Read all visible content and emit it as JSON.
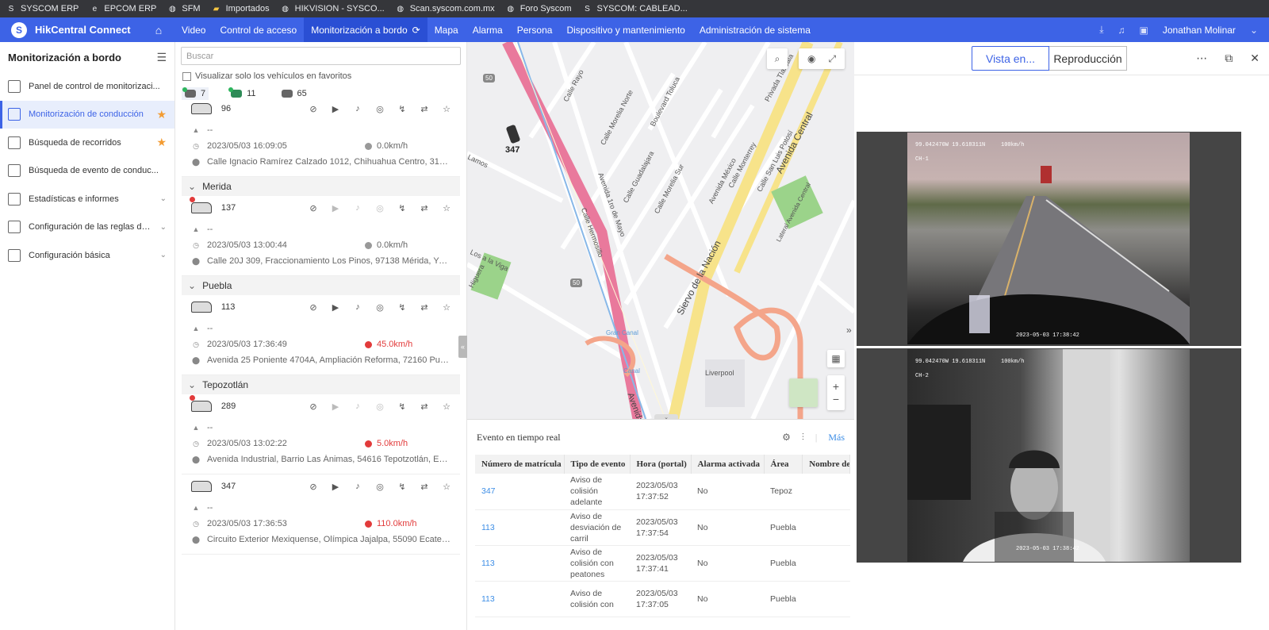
{
  "bookmarks": [
    {
      "icon": "syscom-icon",
      "label": "SYSCOM ERP"
    },
    {
      "icon": "epcom-icon",
      "label": "EPCOM ERP"
    },
    {
      "icon": "globe-icon",
      "label": "SFM"
    },
    {
      "icon": "folder-icon",
      "label": "Importados"
    },
    {
      "icon": "globe-icon",
      "label": "HIKVISION - SYSCO..."
    },
    {
      "icon": "globe-icon",
      "label": "Scan.syscom.com.mx"
    },
    {
      "icon": "globe-icon",
      "label": "Foro Syscom"
    },
    {
      "icon": "syscom-icon",
      "label": "SYSCOM: CABLEAD..."
    }
  ],
  "app": {
    "name": "HikCentral Connect",
    "nav": [
      "Video",
      "Control de acceso",
      "Monitorización a bordo",
      "Mapa",
      "Alarma",
      "Persona",
      "Dispositivo y mantenimiento",
      "Administración de sistema"
    ],
    "active_nav": "Monitorización a bordo",
    "user": "Jonathan Molinar"
  },
  "sidebar": {
    "title": "Monitorización a bordo",
    "items": [
      {
        "label": "Panel de control de monitorizaci...",
        "active": false,
        "star": false,
        "expand": false
      },
      {
        "label": "Monitorización de conducción",
        "active": true,
        "star": true,
        "expand": false
      },
      {
        "label": "Búsqueda de recorridos",
        "active": false,
        "star": true,
        "expand": false
      },
      {
        "label": "Búsqueda de evento de conduc...",
        "active": false,
        "star": false,
        "expand": false
      },
      {
        "label": "Estadísticas e informes",
        "active": false,
        "star": false,
        "expand": true
      },
      {
        "label": "Configuración de las reglas de c...",
        "active": false,
        "star": false,
        "expand": true
      },
      {
        "label": "Configuración básica",
        "active": false,
        "star": false,
        "expand": true
      }
    ]
  },
  "vehicles": {
    "search_placeholder": "Buscar",
    "favorites_label": "Visualizar solo los vehículos en favoritos",
    "counts": [
      "7",
      "11",
      "65"
    ],
    "groups": [
      {
        "name": "",
        "items": [
          {
            "id": "96",
            "offline": false,
            "driver": "--",
            "time": "2023/05/03 16:09:05",
            "speed": "0.0km/h",
            "alert": false,
            "address": "Calle Ignacio Ramírez Calzado 1012, Chihuahua Centro, 31000 Chi..."
          }
        ]
      },
      {
        "name": "Merida",
        "items": [
          {
            "id": "137",
            "offline": true,
            "driver": "--",
            "time": "2023/05/03 13:00:44",
            "speed": "0.0km/h",
            "alert": false,
            "address": "Calle 20J 309, Fraccionamiento Los Pinos, 97138 Mérida, Yuc, Méxi..."
          }
        ]
      },
      {
        "name": "Puebla",
        "items": [
          {
            "id": "113",
            "offline": false,
            "driver": "--",
            "time": "2023/05/03 17:36:49",
            "speed": "45.0km/h",
            "alert": true,
            "address": "Avenida 25 Poniente 4704A, Ampliación Reforma, 72160 Puebla, P..."
          }
        ]
      },
      {
        "name": "Tepozotlán",
        "items": [
          {
            "id": "289",
            "offline": true,
            "driver": "--",
            "time": "2023/05/03 13:02:22",
            "speed": "5.0km/h",
            "alert": true,
            "address": "Avenida Industrial, Barrio Las Ánimas, 54616 Tepotzotlán, Edomex,..."
          },
          {
            "id": "347",
            "offline": false,
            "driver": "--",
            "time": "2023/05/03 17:36:53",
            "speed": "110.0km/h",
            "alert": true,
            "address": "Circuito Exterior Mexiquense, Olímpica Jajalpa, 55090 Ecatepec de..."
          }
        ]
      }
    ]
  },
  "map": {
    "vehicle_label": "347",
    "labels": [
      "Calle Rayo",
      "Calle Morelia Norte",
      "Boulevard Toluca",
      "Calle Guadalajara",
      "Calle Morelia Sur",
      "Avenida México",
      "Calle Monterrey",
      "Calle San Luis Potosí",
      "Privada Tlaxcala",
      "Avenida Central",
      "Lateral Avenida Central",
      "Avenida 1ro de Mayo",
      "Calle Hermosillo",
      "Siervo de la Nación",
      "Gran Canal",
      "Liverpool",
      "Canal",
      "Lamos",
      "Higuera",
      "Los a la Viga",
      "Avenida"
    ],
    "shield_top": "50",
    "shield_mid": "50",
    "zoom_in": "+",
    "zoom_out": "−"
  },
  "events": {
    "title": "Evento en tiempo real",
    "more": "Más",
    "columns": [
      "Número de matrícula",
      "Tipo de evento",
      "Hora (portal)",
      "Alarma activada",
      "Área",
      "Nombre del"
    ],
    "rows": [
      {
        "plate": "347",
        "type": "Aviso de colisión adelante",
        "time": "2023/05/03 17:37:52",
        "alarm": "No",
        "area": "Tepoz"
      },
      {
        "plate": "113",
        "type": "Aviso de desviación de carril",
        "time": "2023/05/03 17:37:54",
        "alarm": "No",
        "area": "Puebla"
      },
      {
        "plate": "113",
        "type": "Aviso de colisión con peatones",
        "time": "2023/05/03 17:37:41",
        "alarm": "No",
        "area": "Puebla"
      },
      {
        "plate": "113",
        "type": "Aviso de colisión con",
        "time": "2023/05/03 17:37:05",
        "alarm": "No",
        "area": "Puebla"
      }
    ]
  },
  "live": {
    "live_tab": "Vista en...",
    "playback_tab": "Reproducción",
    "cameras": [
      {
        "coords": "99.042470W 19.618311N",
        "speed": "100km/h",
        "channel": "CH-1",
        "timestamp": "2023-05-03 17:38:42"
      },
      {
        "coords": "99.042470W 19.618311N",
        "speed": "100km/h",
        "channel": "CH-2",
        "timestamp": "2023-05-03 17:38:42"
      }
    ]
  }
}
